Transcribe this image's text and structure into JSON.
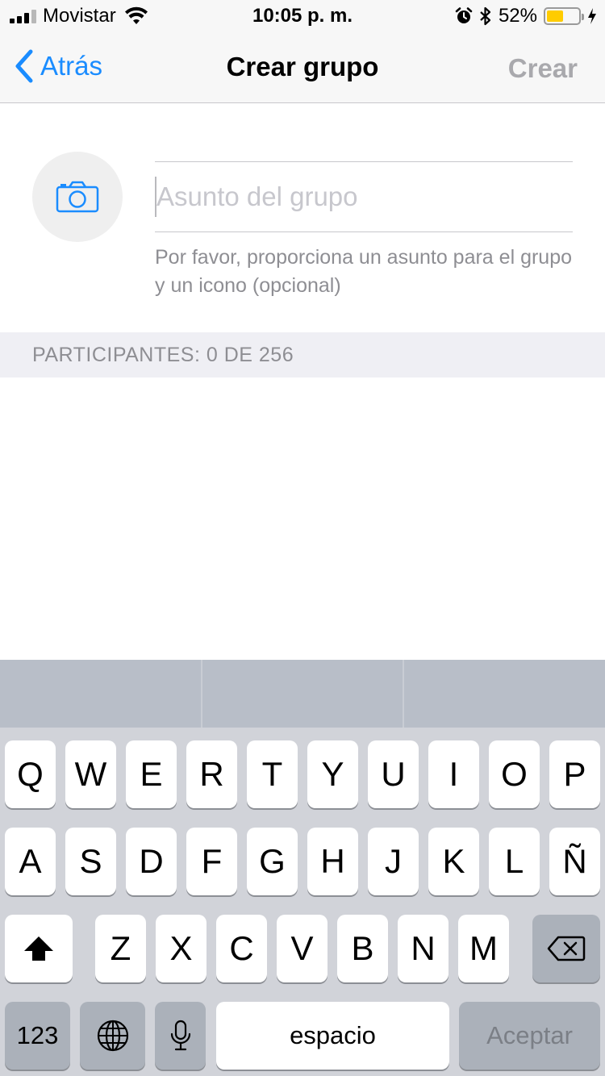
{
  "status_bar": {
    "carrier": "Movistar",
    "time": "10:05 p. m.",
    "battery_percent": "52%",
    "battery_level": 0.52,
    "icons": [
      "signal-icon",
      "wifi-icon",
      "alarm-icon",
      "bluetooth-icon",
      "battery-icon",
      "charging-icon"
    ]
  },
  "nav": {
    "back_label": "Atrás",
    "title": "Crear grupo",
    "create_label": "Crear"
  },
  "subject": {
    "placeholder": "Asunto del grupo",
    "hint": "Por favor, proporciona un asunto para el grupo y un icono (opcional)"
  },
  "participants": {
    "label": "PARTICIPANTES: 0 DE 256"
  },
  "keyboard": {
    "row1": [
      "Q",
      "W",
      "E",
      "R",
      "T",
      "Y",
      "U",
      "I",
      "O",
      "P"
    ],
    "row2": [
      "A",
      "S",
      "D",
      "F",
      "G",
      "H",
      "J",
      "K",
      "L",
      "Ñ"
    ],
    "row3": [
      "Z",
      "X",
      "C",
      "V",
      "B",
      "N",
      "M"
    ],
    "numbers_label": "123",
    "space_label": "espacio",
    "return_label": "Aceptar"
  },
  "colors": {
    "accent": "#1a8cff",
    "battery": "#ffcc00",
    "disabled": "#a9a9ad"
  }
}
